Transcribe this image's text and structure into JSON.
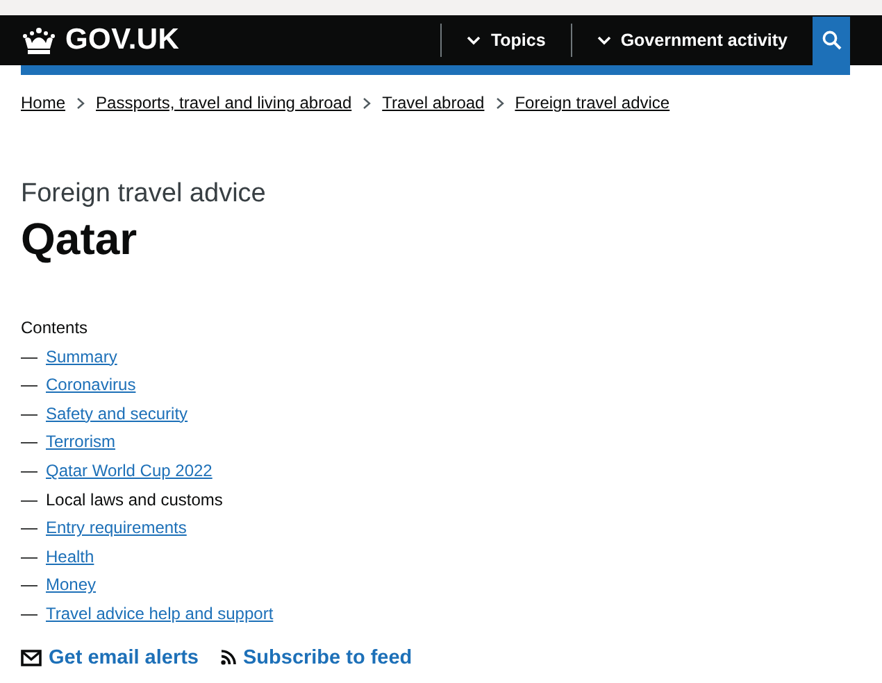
{
  "header": {
    "logo": "GOV.UK",
    "nav": [
      {
        "label": "Topics"
      },
      {
        "label": "Government activity"
      }
    ]
  },
  "breadcrumbs": [
    {
      "label": "Home"
    },
    {
      "label": "Passports, travel and living abroad"
    },
    {
      "label": "Travel abroad"
    },
    {
      "label": "Foreign travel advice"
    }
  ],
  "caption": "Foreign travel advice",
  "title": "Qatar",
  "contents": {
    "heading": "Contents",
    "items": [
      {
        "marker": "—",
        "label": "Summary",
        "selected": false
      },
      {
        "marker": "—",
        "label": "Coronavirus",
        "selected": false
      },
      {
        "marker": "—",
        "label": "Safety and security",
        "selected": false
      },
      {
        "marker": "—",
        "label": "Terrorism",
        "selected": false
      },
      {
        "marker": "—",
        "label": "Qatar World Cup 2022",
        "selected": false
      },
      {
        "marker": "—",
        "label": "Local laws and customs",
        "selected": true
      },
      {
        "marker": "—",
        "label": "Entry requirements",
        "selected": false
      },
      {
        "marker": "—",
        "label": "Health",
        "selected": false
      },
      {
        "marker": "—",
        "label": "Money",
        "selected": false
      },
      {
        "marker": "—",
        "label": "Travel advice help and support",
        "selected": false
      }
    ]
  },
  "actions": [
    {
      "kind": "email",
      "label": "Get email alerts"
    },
    {
      "kind": "feed",
      "label": "Subscribe to feed"
    }
  ]
}
